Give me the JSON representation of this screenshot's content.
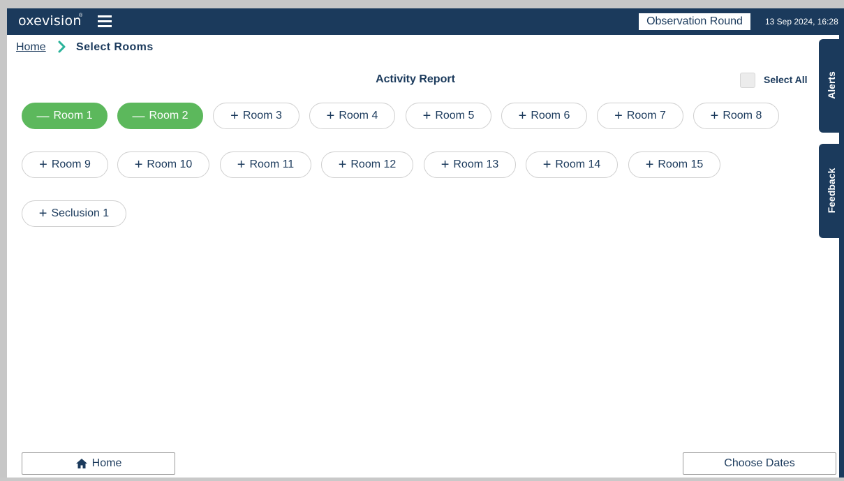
{
  "header": {
    "brand": "oxevision",
    "brand_mark": "®",
    "observation_button": "Observation Round",
    "datetime": "13 Sep 2024, 16:28"
  },
  "breadcrumb": {
    "home": "Home",
    "current": "Select Rooms"
  },
  "report": {
    "title": "Activity Report",
    "select_all": "Select All"
  },
  "rooms": [
    {
      "label": "Room 1",
      "selected": true,
      "symbol": "—"
    },
    {
      "label": "Room 2",
      "selected": true,
      "symbol": "—"
    },
    {
      "label": "Room 3",
      "selected": false,
      "symbol": "+"
    },
    {
      "label": "Room 4",
      "selected": false,
      "symbol": "+"
    },
    {
      "label": "Room 5",
      "selected": false,
      "symbol": "+"
    },
    {
      "label": "Room 6",
      "selected": false,
      "symbol": "+"
    },
    {
      "label": "Room 7",
      "selected": false,
      "symbol": "+"
    },
    {
      "label": "Room 8",
      "selected": false,
      "symbol": "+"
    },
    {
      "label": "Room 9",
      "selected": false,
      "symbol": "+"
    },
    {
      "label": "Room 10",
      "selected": false,
      "symbol": "+"
    },
    {
      "label": "Room 11",
      "selected": false,
      "symbol": "+"
    },
    {
      "label": "Room 12",
      "selected": false,
      "symbol": "+"
    },
    {
      "label": "Room 13",
      "selected": false,
      "symbol": "+"
    },
    {
      "label": "Room 14",
      "selected": false,
      "symbol": "+"
    },
    {
      "label": "Room 15",
      "selected": false,
      "symbol": "+"
    },
    {
      "label": "Seclusion 1",
      "selected": false,
      "symbol": "+"
    }
  ],
  "side_tabs": {
    "alerts": "Alerts",
    "feedback": "Feedback"
  },
  "footer": {
    "home": "Home",
    "choose_dates": "Choose Dates"
  },
  "colors": {
    "navy": "#1b3a5c",
    "selected_green": "#5cb85c",
    "chevron_teal": "#2bb39a"
  },
  "icons": {
    "menu": "hamburger-icon",
    "breadcrumb_separator": "chevron-right-icon",
    "home": "house-icon"
  }
}
